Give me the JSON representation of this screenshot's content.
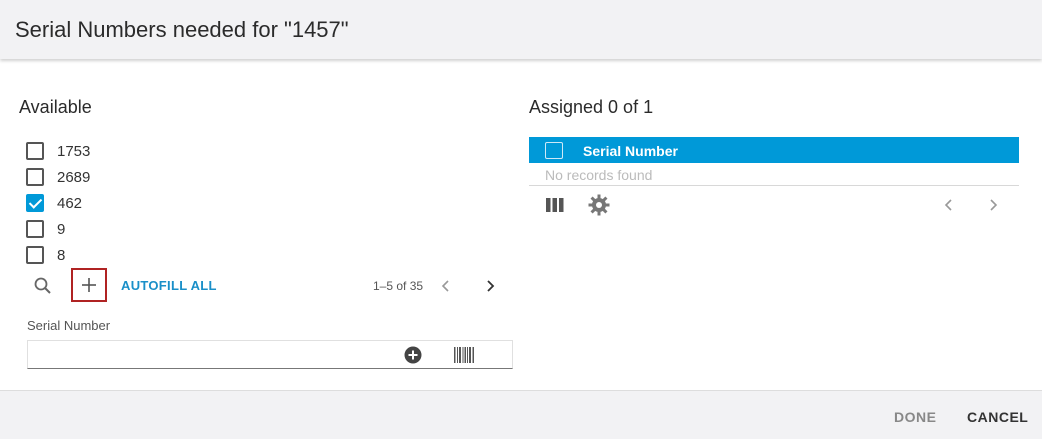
{
  "dialog": {
    "title": "Serial Numbers needed for \"1457\""
  },
  "available": {
    "title": "Available",
    "items": [
      {
        "label": "1753",
        "checked": false
      },
      {
        "label": "2689",
        "checked": false
      },
      {
        "label": "462",
        "checked": true
      },
      {
        "label": "9",
        "checked": false
      },
      {
        "label": "8",
        "checked": false
      }
    ],
    "toolbar": {
      "search_icon": "search-icon",
      "add_icon": "plus-icon",
      "autofill_label": "AUTOFILL ALL",
      "pager_text": "1–5 of 35"
    },
    "serial_field": {
      "label": "Serial Number",
      "value": "",
      "add_icon": "add-circle-icon",
      "barcode_icon": "barcode-icon"
    }
  },
  "assigned": {
    "title": "Assigned 0 of 1",
    "columns": [
      "Serial Number"
    ],
    "empty_text": "No records found",
    "accent_color": "#0099d8"
  },
  "footer": {
    "done_label": "DONE",
    "cancel_label": "CANCEL"
  }
}
